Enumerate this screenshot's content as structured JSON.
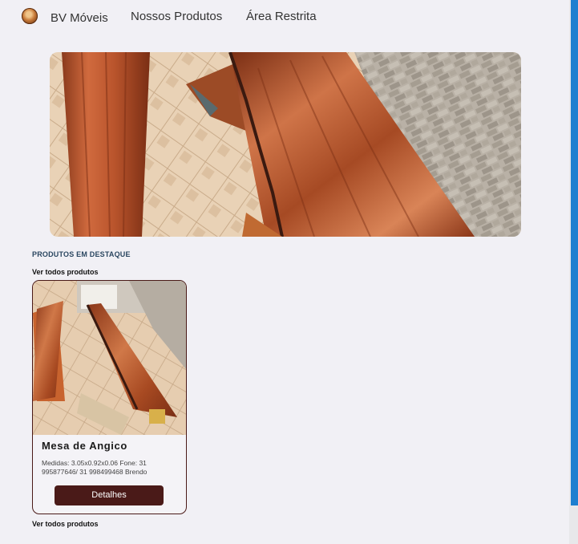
{
  "nav": {
    "brand": "BV Móveis",
    "links": [
      "Nossos Produtos",
      "Área Restrita"
    ]
  },
  "featured": {
    "title": "PRODUTOS EM DESTAQUE",
    "see_all": "Ver todos produtos"
  },
  "product": {
    "name": "Mesa de Angico",
    "description": "Medidas: 3.05x0.92x0.06 Fone: 31 995877646/ 31 998499468 Brendo",
    "button": "Detalhes"
  },
  "colors": {
    "accent": "#4a1a18",
    "background": "#f1f0f5",
    "section_title": "#2a4660",
    "scrollbar": "#1e7fd0"
  }
}
